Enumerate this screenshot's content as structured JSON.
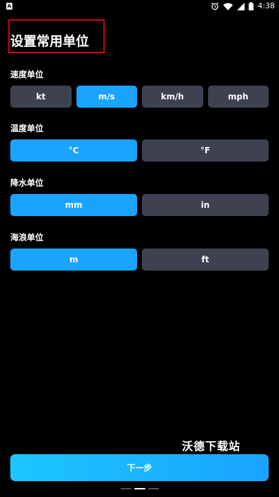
{
  "status_bar": {
    "app_icon_letter": "A",
    "time": "4:38",
    "icons": [
      "alarm-icon",
      "wifi-icon",
      "signal-icon",
      "battery-icon"
    ]
  },
  "title": "设置常用单位",
  "sections": {
    "speed": {
      "label": "速度单位",
      "options": [
        "kt",
        "m/s",
        "km/h",
        "mph"
      ],
      "selected": "m/s"
    },
    "temperature": {
      "label": "温度单位",
      "options": [
        "°C",
        "°F"
      ],
      "selected": "°C"
    },
    "precipitation": {
      "label": "降水单位",
      "options": [
        "mm",
        "in"
      ],
      "selected": "mm"
    },
    "wave": {
      "label": "海浪单位",
      "options": [
        "m",
        "ft"
      ],
      "selected": "m"
    }
  },
  "watermark": "沃德下载站",
  "next_button_label": "下一步",
  "page_indicator": {
    "total": 3,
    "current": 2
  },
  "colors": {
    "background": "#000000",
    "selected": "#1aa3ff",
    "unselected": "#3e4150",
    "highlight_box": "#d0021b"
  }
}
